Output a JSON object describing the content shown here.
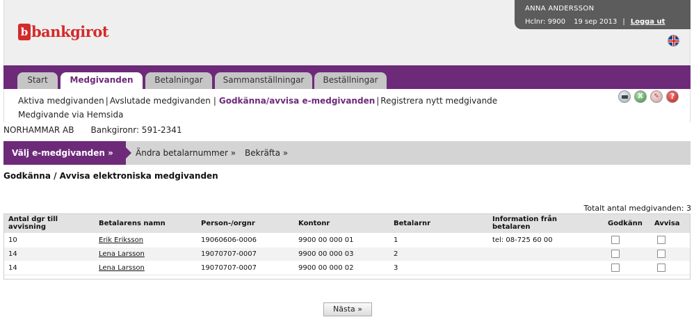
{
  "header": {
    "logo_mark": "b",
    "logo_text": "bankgirot",
    "user_name": "ANNA ANDERSSON",
    "customer_no": "Hclnr: 9900",
    "date": "19 sep 2013",
    "divider": "|",
    "logout_label": "Logga ut",
    "language_icon": "uk-flag-icon"
  },
  "nav": {
    "tabs": [
      {
        "label": "Start",
        "active": false
      },
      {
        "label": "Medgivanden",
        "active": true
      },
      {
        "label": "Betalningar",
        "active": false
      },
      {
        "label": "Sammanställningar",
        "active": false
      },
      {
        "label": "Beställningar",
        "active": false
      }
    ]
  },
  "subnav": {
    "links": [
      {
        "label": "Aktiva medgivanden"
      },
      {
        "label": "Avslutade medgivanden"
      },
      {
        "label": "Godkänna/avvisa e-medgivanden",
        "active": true
      },
      {
        "label": "Registrera nytt medgivande"
      },
      {
        "label": "Medgivande via Hemsida"
      }
    ],
    "separator": "|",
    "tools": [
      "print-icon",
      "excel-icon",
      "pdf-icon",
      "help-icon"
    ],
    "excel_glyph": "X",
    "pdf_glyph": "✎",
    "help_glyph": "?"
  },
  "company": {
    "name": "NORHAMMAR AB",
    "bankgiro": "Bankgironr: 591-2341"
  },
  "steps": {
    "active": "Välj e-medgivanden »",
    "items": [
      "Ändra betalarnummer »",
      "Bekräfta »"
    ]
  },
  "page_title": "Godkänna / Avvisa elektroniska medgivanden",
  "total_label": "Totalt antal medgivanden:",
  "total_value": "3",
  "table": {
    "headers": {
      "days": "Antal dgr till avvisning",
      "name": "Betalarens namn",
      "person": "Person-/orgnr",
      "account": "Kontonr",
      "payer_no": "Betalarnr",
      "info": "Information från betalaren",
      "approve": "Godkänn",
      "reject": "Avvisa"
    },
    "rows": [
      {
        "days": "10",
        "name": "Erik Eriksson",
        "person": "19060606-0006",
        "account": "9900 00 000 01",
        "payer_no": "1",
        "info": "tel: 08-725 60 00"
      },
      {
        "days": "14",
        "name": "Lena Larsson",
        "person": "19070707-0007",
        "account": "9900 00 000 03",
        "payer_no": "2",
        "info": ""
      },
      {
        "days": "14",
        "name": "Lena Larsson",
        "person": "19070707-0007",
        "account": "9900 00 000 02",
        "payer_no": "3",
        "info": ""
      }
    ]
  },
  "next_button": "Nästa »",
  "colors": {
    "brand_purple": "#6d2a79",
    "brand_red": "#d42a2a",
    "userbox_bg": "#5c5c5c"
  }
}
